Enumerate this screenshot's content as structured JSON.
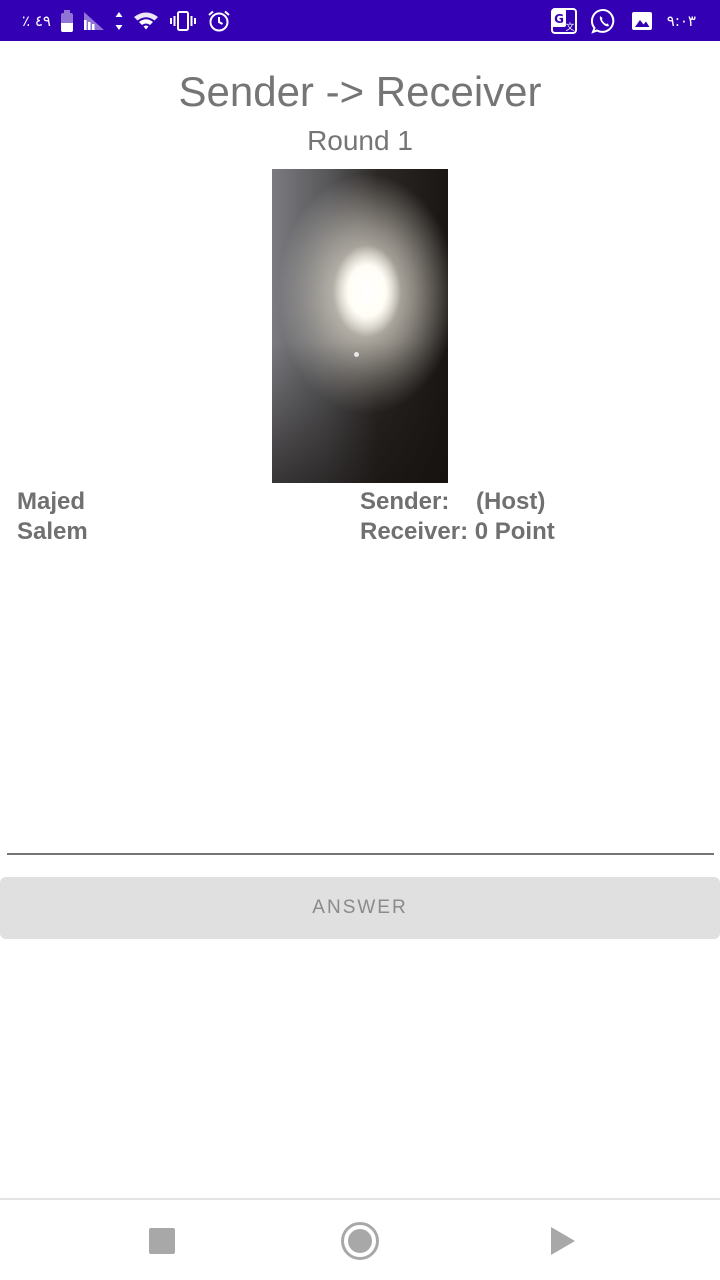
{
  "status_bar": {
    "battery_text": "٪ ٤٩",
    "battery_level": 0.49,
    "time": "٩:٠٣",
    "background_color": "#3300b3",
    "left_icons": [
      "battery-icon",
      "signal-icon",
      "data-arrows-icon",
      "wifi-icon",
      "vibrate-icon",
      "alarm-icon"
    ],
    "right_icons": [
      "translate-icon",
      "whatsapp-icon",
      "gallery-icon"
    ]
  },
  "main": {
    "title": "Sender -> Receiver",
    "round_label": "Round 1"
  },
  "players": {
    "names": [
      "Majed",
      "Salem"
    ],
    "sender_line": "Sender:    (Host)",
    "receiver_line": "Receiver: 0 Point"
  },
  "actions": {
    "answer_label": "ANSWER"
  },
  "nav_bar": {
    "icons": [
      "recent-apps-icon",
      "home-icon",
      "back-icon"
    ]
  }
}
